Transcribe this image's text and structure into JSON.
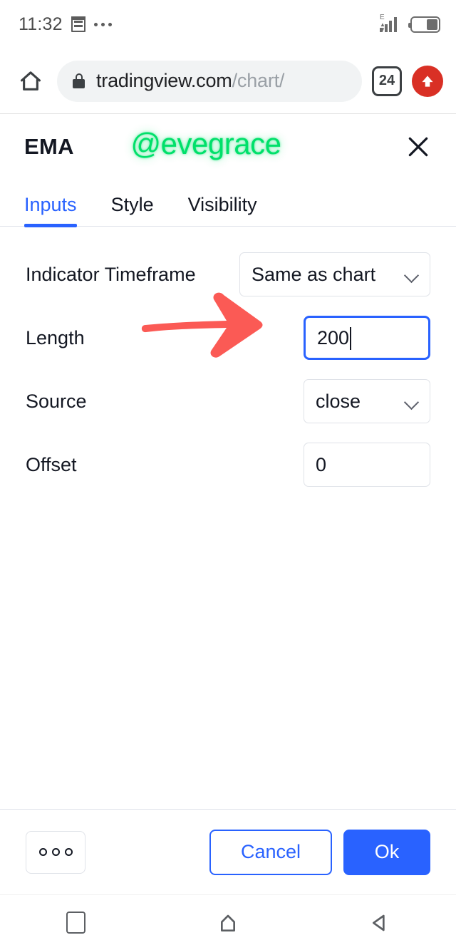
{
  "status_bar": {
    "time": "11:32",
    "notification_icon": "notification-list-icon",
    "more_icon": "three-dots-icon",
    "network_label": "E",
    "signal_icon": "signal-bars-icon",
    "battery_icon": "battery-icon"
  },
  "browser": {
    "home_icon": "home-icon",
    "lock_icon": "lock-icon",
    "url_domain": "tradingview.com",
    "url_path": "/chart/",
    "tab_count": "24",
    "update_icon": "upload-arrow-icon"
  },
  "dialog": {
    "title": "EMA",
    "watermark": "@evegrace",
    "close_icon": "close-icon",
    "tabs": [
      {
        "label": "Inputs",
        "active": true
      },
      {
        "label": "Style",
        "active": false
      },
      {
        "label": "Visibility",
        "active": false
      }
    ],
    "fields": [
      {
        "label": "Indicator Timeframe",
        "type": "select",
        "value": "Same as chart",
        "icon": "chevron-down-icon"
      },
      {
        "label": "Length",
        "type": "input",
        "value": "200",
        "focused": true
      },
      {
        "label": "Source",
        "type": "select",
        "value": "close",
        "icon": "chevron-down-icon"
      },
      {
        "label": "Offset",
        "type": "input",
        "value": "0",
        "focused": false
      }
    ],
    "annotation": {
      "shape": "red-arrow-right",
      "color": "#fb5a55",
      "points_to": "Length"
    },
    "footer": {
      "more_label": "ooo",
      "more_icon": "three-circles-icon",
      "cancel_label": "Cancel",
      "ok_label": "Ok"
    }
  },
  "android_nav": {
    "recents_icon": "square-recents-icon",
    "home_icon": "home-pentagon-icon",
    "back_icon": "back-triangle-icon"
  },
  "colors": {
    "accent_blue": "#2962ff",
    "watermark_green": "#00e06a",
    "annotation_red": "#fb5a55",
    "update_red": "#d93025",
    "text_dark": "#131722"
  }
}
